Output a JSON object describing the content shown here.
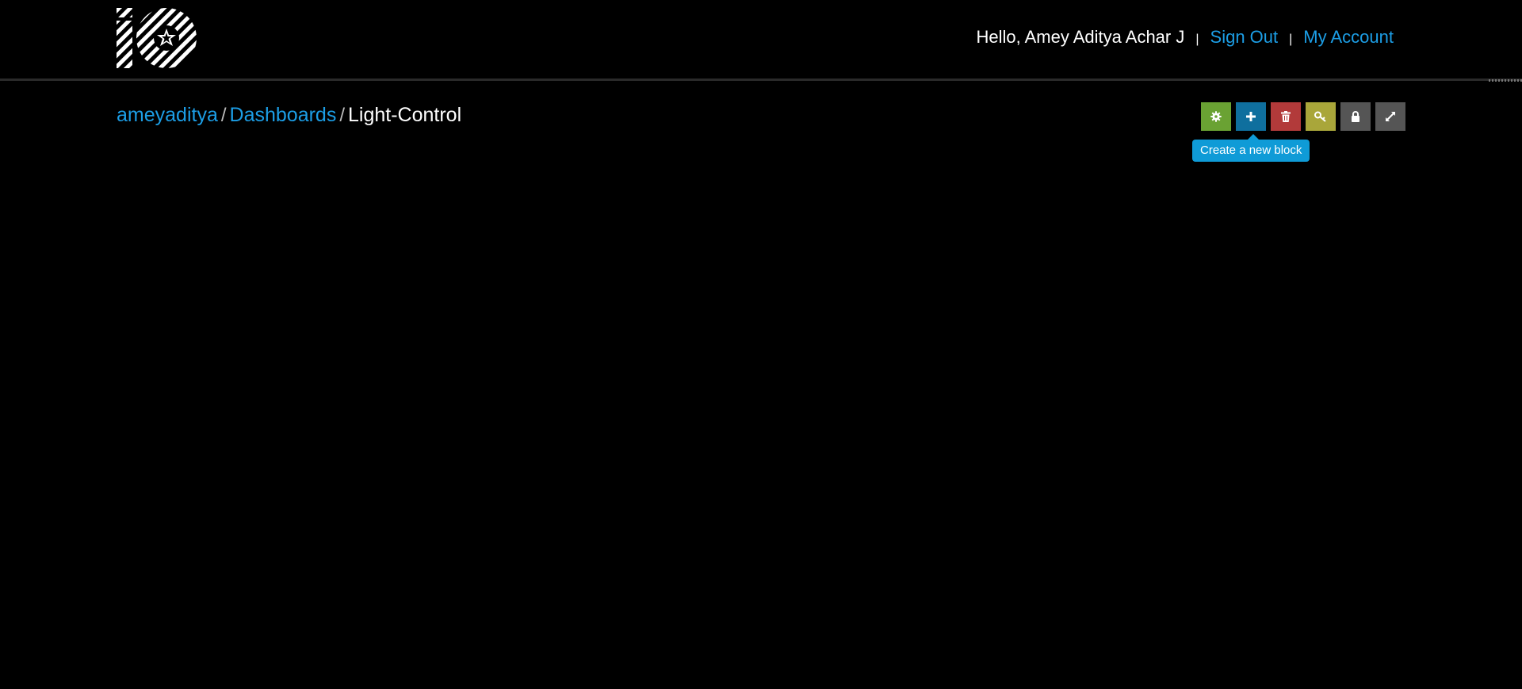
{
  "header": {
    "logo_icon": "adafruit-io-logo",
    "greeting": "Hello, Amey Aditya Achar J",
    "separator": "|",
    "sign_out": "Sign Out",
    "my_account": "My Account",
    "link_color": "#1c9ee6"
  },
  "breadcrumb": {
    "user": "ameyaditya",
    "slash": "/",
    "section": "Dashboards",
    "current": "Light-Control"
  },
  "toolbar": {
    "buttons": [
      {
        "name": "settings",
        "icon": "gear-icon",
        "color": "#6aa233"
      },
      {
        "name": "add-block",
        "icon": "plus-icon",
        "color": "#0f6f9e"
      },
      {
        "name": "delete",
        "icon": "trash-icon",
        "color": "#b23a3a"
      },
      {
        "name": "key",
        "icon": "key-icon",
        "color": "#a9a63a"
      },
      {
        "name": "lock",
        "icon": "lock-icon",
        "color": "#555555"
      },
      {
        "name": "fullscreen",
        "icon": "expand-icon",
        "color": "#555555"
      }
    ],
    "tooltip": "Create a new block",
    "tooltip_color": "#0f9bd7"
  }
}
